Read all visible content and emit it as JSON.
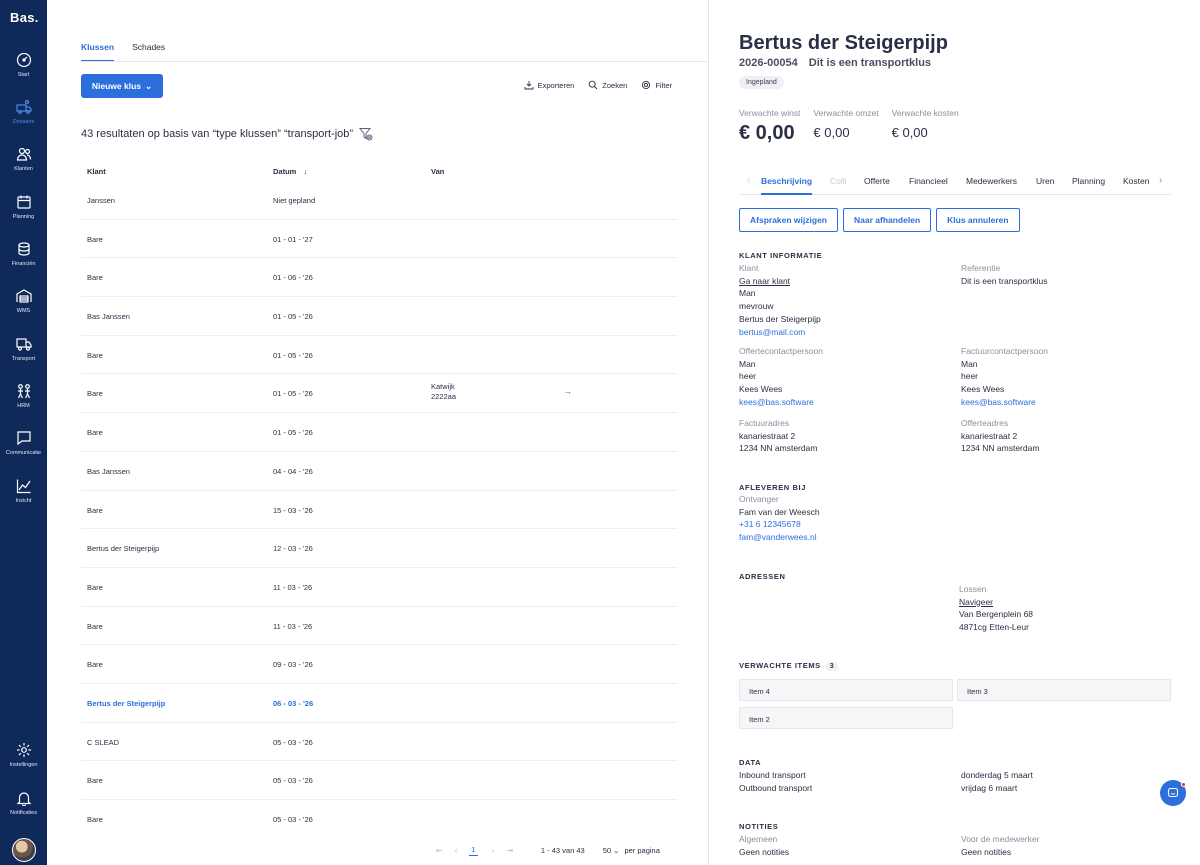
{
  "app": {
    "logo": "Bas."
  },
  "sidebar": {
    "items": [
      {
        "label": "Start",
        "icon": "gauge-icon"
      },
      {
        "label": "Dossiers",
        "icon": "truck-user-icon",
        "active": true
      },
      {
        "label": "Klanten",
        "icon": "users-icon"
      },
      {
        "label": "Planning",
        "icon": "calendar-icon"
      },
      {
        "label": "Financiën",
        "icon": "coins-icon"
      },
      {
        "label": "WMS",
        "icon": "warehouse-icon"
      },
      {
        "label": "Transport",
        "icon": "truck-icon"
      },
      {
        "label": "HRM",
        "icon": "people-icon"
      },
      {
        "label": "Communicatie",
        "icon": "chat-bubble-icon"
      },
      {
        "label": "Inzicht",
        "icon": "chart-line-icon"
      }
    ],
    "bottom_items": [
      {
        "label": "Instellingen",
        "icon": "gear-icon"
      },
      {
        "label": "Notificaties",
        "icon": "bell-icon"
      }
    ]
  },
  "list": {
    "tabs": [
      {
        "label": "Klussen",
        "active": true
      },
      {
        "label": "Schades",
        "active": false
      }
    ],
    "new_button": "Nieuwe klus",
    "toolbar": {
      "export": "Exporteren",
      "search": "Zoeken",
      "filter": "Filter"
    },
    "results_text": "43 resultaten op basis van “type klussen” “transport-job”",
    "columns": {
      "klant": "Klant",
      "datum": "Datum",
      "van": "Van"
    },
    "rows": [
      {
        "klant": "Janssen",
        "datum": "Niet gepland",
        "van1": "",
        "van2": "",
        "arrow": ""
      },
      {
        "klant": "Bare",
        "datum": "01 - 01 - '27",
        "van1": "",
        "van2": "",
        "arrow": ""
      },
      {
        "klant": "Bare",
        "datum": "01 - 06 - '26",
        "van1": "",
        "van2": "",
        "arrow": ""
      },
      {
        "klant": "Bas Janssen",
        "datum": "01 - 05 - '26",
        "van1": "",
        "van2": "",
        "arrow": ""
      },
      {
        "klant": "Bare",
        "datum": "01 - 05 - '26",
        "van1": "",
        "van2": "",
        "arrow": ""
      },
      {
        "klant": "Bare",
        "datum": "01 - 05 - '26",
        "van1": "Katwijk",
        "van2": "2222aa",
        "arrow": "→"
      },
      {
        "klant": "Bare",
        "datum": "01 - 05 - '26",
        "van1": "",
        "van2": "",
        "arrow": ""
      },
      {
        "klant": "Bas Janssen",
        "datum": "04 - 04 - '26",
        "van1": "",
        "van2": "",
        "arrow": ""
      },
      {
        "klant": "Bare",
        "datum": "15 - 03 - '26",
        "van1": "",
        "van2": "",
        "arrow": ""
      },
      {
        "klant": "Bertus der Steigerpijp",
        "datum": "12 - 03 - '26",
        "van1": "",
        "van2": "",
        "arrow": ""
      },
      {
        "klant": "Bare",
        "datum": "11 - 03 - '26",
        "van1": "",
        "van2": "",
        "arrow": ""
      },
      {
        "klant": "Bare",
        "datum": "11 - 03 - '26",
        "van1": "",
        "van2": "",
        "arrow": ""
      },
      {
        "klant": "Bare",
        "datum": "09 - 03 - '26",
        "van1": "",
        "van2": "",
        "arrow": ""
      },
      {
        "klant": "Bertus der Steigerpijp",
        "datum": "06 - 03 - '26",
        "van1": "",
        "van2": "",
        "arrow": "",
        "highlight": true
      },
      {
        "klant": "C SLEAD",
        "datum": "05 - 03 - '26",
        "van1": "",
        "van2": "",
        "arrow": ""
      },
      {
        "klant": "Bare",
        "datum": "05 - 03 - '26",
        "van1": "",
        "van2": "",
        "arrow": ""
      },
      {
        "klant": "Bare",
        "datum": "05 - 03 - '26",
        "van1": "",
        "van2": "",
        "arrow": ""
      }
    ],
    "pagination": {
      "current_page": "1",
      "range": "1 - 43 van 43",
      "per_page": "50",
      "per_page_label": "per pagina"
    }
  },
  "detail": {
    "title": "Bertus der Steigerpijp",
    "number": "2026-00054",
    "subtitle": "Dit is een transportklus",
    "status": "Ingepland",
    "metrics": [
      {
        "label": "Verwachte winst",
        "value": "€ 0,00"
      },
      {
        "label": "Verwachte omzet",
        "value": "€ 0,00"
      },
      {
        "label": "Verwachte kosten",
        "value": "€ 0,00"
      }
    ],
    "tabs": [
      "Beschrijving",
      "Colli",
      "Offerte",
      "Financieel",
      "Medewerkers",
      "Uren",
      "Planning",
      "Kosten"
    ],
    "actions": [
      "Afspraken wijzigen",
      "Naar afhandelen",
      "Klus annuleren"
    ],
    "klant_info": {
      "heading": "KLANT INFORMATIE",
      "klant_label": "Klant",
      "klant_link": "Ga naar klant",
      "klant_gender": "Man",
      "klant_salutation": "mevrouw",
      "klant_name": "Bertus der Steigerpijp",
      "klant_email": "bertus@mail.com",
      "referentie_label": "Referentie",
      "referentie_value": "Dit is een transportklus",
      "offerte_label": "Offertecontactpersoon",
      "offerte_gender": "Man",
      "offerte_salutation": "heer",
      "offerte_name": "Kees Wees",
      "offerte_email": "kees@bas.software",
      "factuur_label": "Factuurcontactpersoon",
      "factuur_gender": "Man",
      "factuur_salutation": "heer",
      "factuur_name": "Kees Wees",
      "factuur_email": "kees@bas.software",
      "factuuradres_label": "Factuuradres",
      "factuuradres_street": "kanariestraat 2",
      "factuuradres_city": "1234 NN amsterdam",
      "offerteadres_label": "Offerteadres",
      "offerteadres_street": "kanariestraat 2",
      "offerteadres_city": "1234 NN amsterdam"
    },
    "afleveren": {
      "heading": "AFLEVEREN BIJ",
      "ontvanger_label": "Ontvanger",
      "name": "Fam van der Weesch",
      "phone": "+31 6 12345678",
      "email": "fam@vanderwees.nl"
    },
    "adressen": {
      "heading": "ADRESSEN",
      "lossen_label": "Lossen",
      "lossen_link": "Navigeer",
      "street": "Van Bergenplein 68",
      "city": "4871cg Etten-Leur"
    },
    "items": {
      "heading": "VERWACHTE ITEMS",
      "count": "3",
      "list": [
        "Item 4",
        "Item 3",
        "Item 2"
      ]
    },
    "data": {
      "heading": "DATA",
      "inbound_label": "Inbound transport",
      "inbound_value": "donderdag 5 maart",
      "outbound_label": "Outbound transport",
      "outbound_value": "vrijdag 6 maart"
    },
    "notities": {
      "heading": "NOTITIES",
      "algemeen_label": "Algemeen",
      "algemeen_value": "Geen notities",
      "medewerker_label": "Voor de medewerker",
      "medewerker_value": "Geen notities"
    }
  },
  "colors": {
    "sidebar": "#0f2a5a",
    "accent": "#2c6fdc",
    "muted": "#8a8fa0"
  }
}
